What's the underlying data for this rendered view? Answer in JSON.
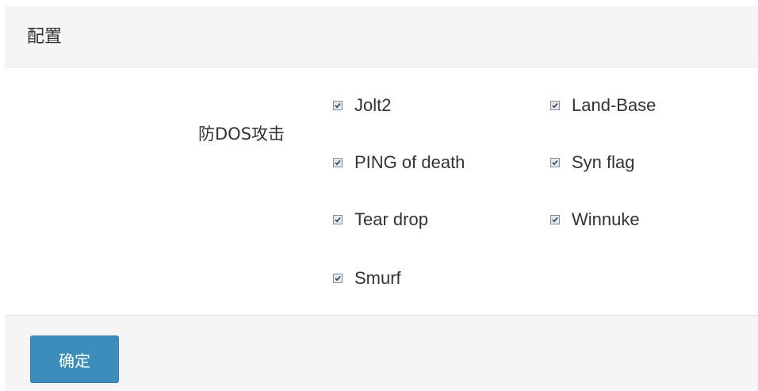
{
  "panel": {
    "title": "配置"
  },
  "form": {
    "field_label": "防DOS攻击",
    "options": [
      {
        "label": "Jolt2",
        "checked": true
      },
      {
        "label": "Land-Base",
        "checked": true
      },
      {
        "label": "PING of death",
        "checked": true
      },
      {
        "label": "Syn flag",
        "checked": true
      },
      {
        "label": "Tear drop",
        "checked": true
      },
      {
        "label": "Winnuke",
        "checked": true
      },
      {
        "label": "Smurf",
        "checked": true
      }
    ]
  },
  "footer": {
    "confirm_label": "确定"
  },
  "colors": {
    "accent": "#3c8dbc",
    "header_bg": "#f5f5f5",
    "text": "#333333"
  }
}
